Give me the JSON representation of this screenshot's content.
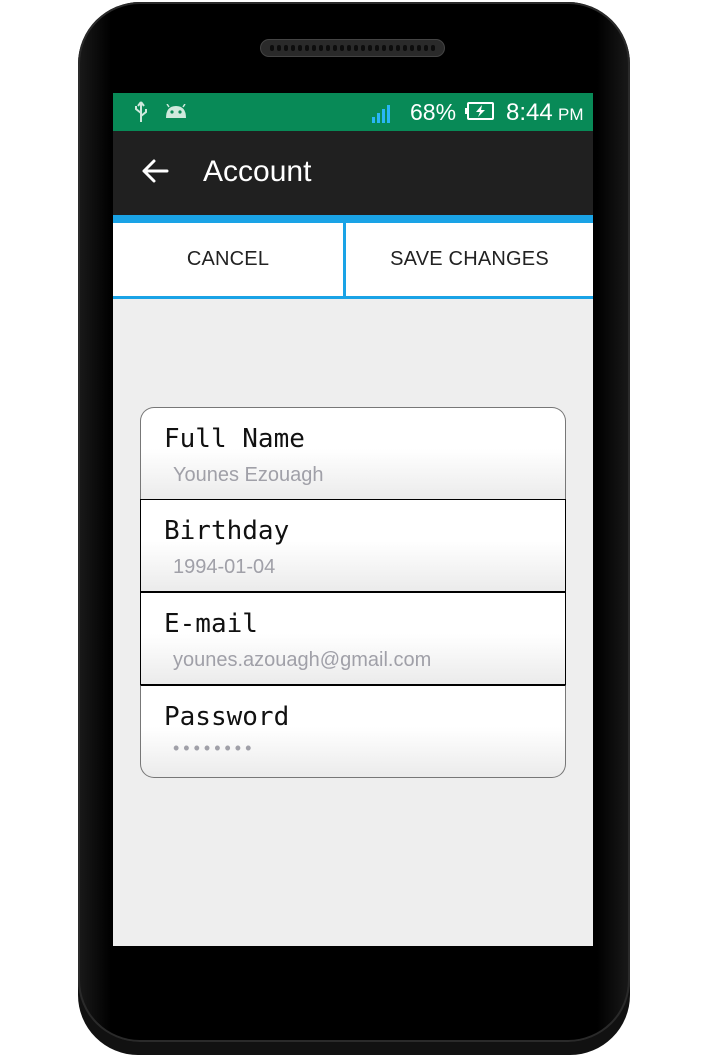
{
  "status_bar": {
    "battery_percent": "68%",
    "time": "8:44",
    "time_suffix": "PM",
    "icons": [
      "usb-icon",
      "android-icon",
      "signal-icon",
      "battery-charging-icon"
    ],
    "background_color": "#088a57"
  },
  "toolbar": {
    "title": "Account",
    "back_icon": "back-arrow-icon",
    "accent_color": "#1aa3e6"
  },
  "actions": {
    "cancel_label": "CANCEL",
    "save_label": "SAVE CHANGES"
  },
  "form": {
    "fields": [
      {
        "label": "Full Name",
        "value": "Younes Ezouagh"
      },
      {
        "label": "Birthday",
        "value": "1994-01-04"
      },
      {
        "label": "E-mail",
        "value": "younes.azouagh@gmail.com"
      },
      {
        "label": "Password",
        "value": "••••••••"
      }
    ]
  }
}
